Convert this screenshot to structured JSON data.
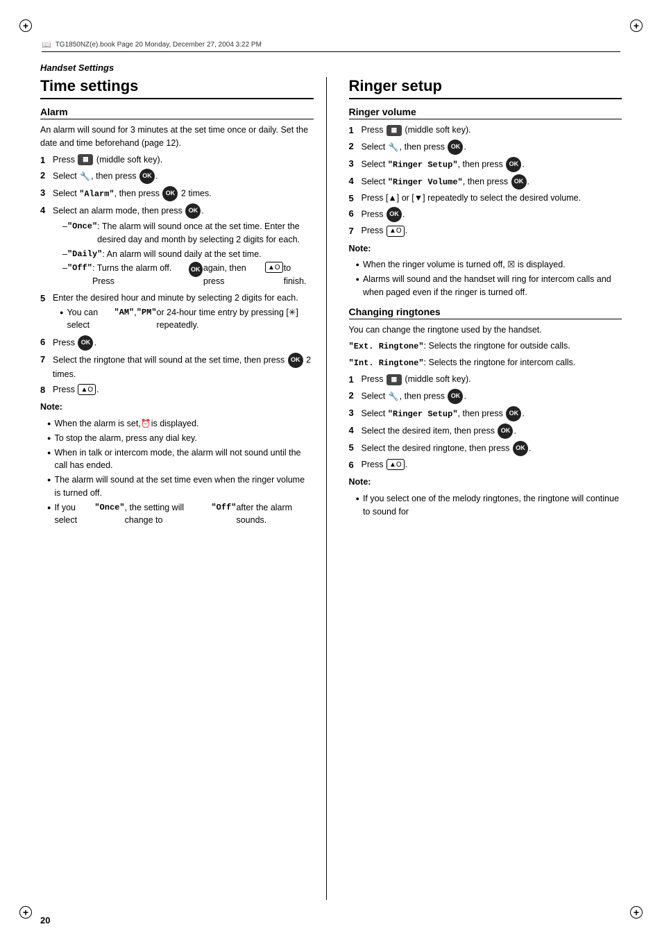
{
  "page": {
    "number": "20",
    "header_info": "TG1850NZ(e).book  Page 20  Monday, December 27, 2004  3:22 PM",
    "section_header": "Handset Settings"
  },
  "left_column": {
    "title": "Time settings",
    "subsection": "Alarm",
    "intro": "An alarm will sound for 3 minutes at the set time once or daily. Set the date and time beforehand (page 12).",
    "steps": [
      {
        "num": "1",
        "text": " (middle soft key)."
      },
      {
        "num": "2",
        "text": ", then press ."
      },
      {
        "num": "3",
        "text": "\"Alarm\", then press  2 times."
      },
      {
        "num": "4",
        "text": "Select an alarm mode, then press ."
      },
      {
        "num": "5",
        "text": "Enter the desired hour and minute by selecting 2 digits for each."
      },
      {
        "num": "6",
        "text": "Press ."
      },
      {
        "num": "7",
        "text": "Select the ringtone that will sound at the set time, then press  2 times."
      },
      {
        "num": "8",
        "text": "Press [▲O]."
      }
    ],
    "dash_items": [
      {
        "key": "\"Once\"",
        "text": ": The alarm will sound once at the set time. Enter the desired day and month by selecting 2 digits for each."
      },
      {
        "key": "\"Daily\"",
        "text": ": An alarm will sound daily at the set time."
      },
      {
        "key": "\"Off\"",
        "text": ": Turns the alarm off. Press  again, then press [▲O] to finish."
      }
    ],
    "step5_bullet": "You can select \"AM\", \"PM\" or 24-hour time entry by pressing [✳] repeatedly.",
    "note_label": "Note:",
    "notes": [
      "When the alarm is set,  is displayed.",
      "To stop the alarm, press any dial key.",
      "When in talk or intercom mode, the alarm will not sound until the call has ended.",
      "The alarm will sound at the set time even when the ringer volume is turned off.",
      "If you select \"Once\", the setting will change to \"Off\" after the alarm sounds."
    ]
  },
  "right_column": {
    "title": "Ringer setup",
    "subsection1": "Ringer volume",
    "ringer_volume_steps": [
      {
        "num": "1",
        "text": " (middle soft key)."
      },
      {
        "num": "2",
        "text": ", then press ."
      },
      {
        "num": "3",
        "text": "\"Ringer Setup\", then press ."
      },
      {
        "num": "4",
        "text": "\"Ringer Volume\", then press ."
      },
      {
        "num": "5",
        "text": "Press [▲] or [▼] repeatedly to select the desired volume."
      },
      {
        "num": "6",
        "text": "Press ."
      },
      {
        "num": "7",
        "text": "Press [▲O]."
      }
    ],
    "ringer_volume_note_label": "Note:",
    "ringer_volume_notes": [
      "When the ringer volume is turned off, ☒ is displayed.",
      "Alarms will sound and the handset will ring for intercom calls and when paged even if the ringer is turned off."
    ],
    "subsection2": "Changing ringtones",
    "changing_intro": "You can change the ringtone used by the handset.",
    "ext_ringtone": "\"Ext. Ringtone\"",
    "ext_ringtone_desc": ": Selects the ringtone for outside calls.",
    "int_ringtone": "\"Int. Ringtone\"",
    "int_ringtone_desc": ": Selects the ringtone for intercom calls.",
    "changing_steps": [
      {
        "num": "1",
        "text": " (middle soft key)."
      },
      {
        "num": "2",
        "text": ", then press ."
      },
      {
        "num": "3",
        "text": "\"Ringer Setup\", then press ."
      },
      {
        "num": "4",
        "text": "Select the desired item, then press ."
      },
      {
        "num": "5",
        "text": "Select the desired ringtone, then press ."
      },
      {
        "num": "6",
        "text": "Press [▲O]."
      }
    ],
    "changing_note_label": "Note:",
    "changing_notes": [
      "If you select one of the melody ringtones, the ringtone will continue to sound for"
    ]
  }
}
